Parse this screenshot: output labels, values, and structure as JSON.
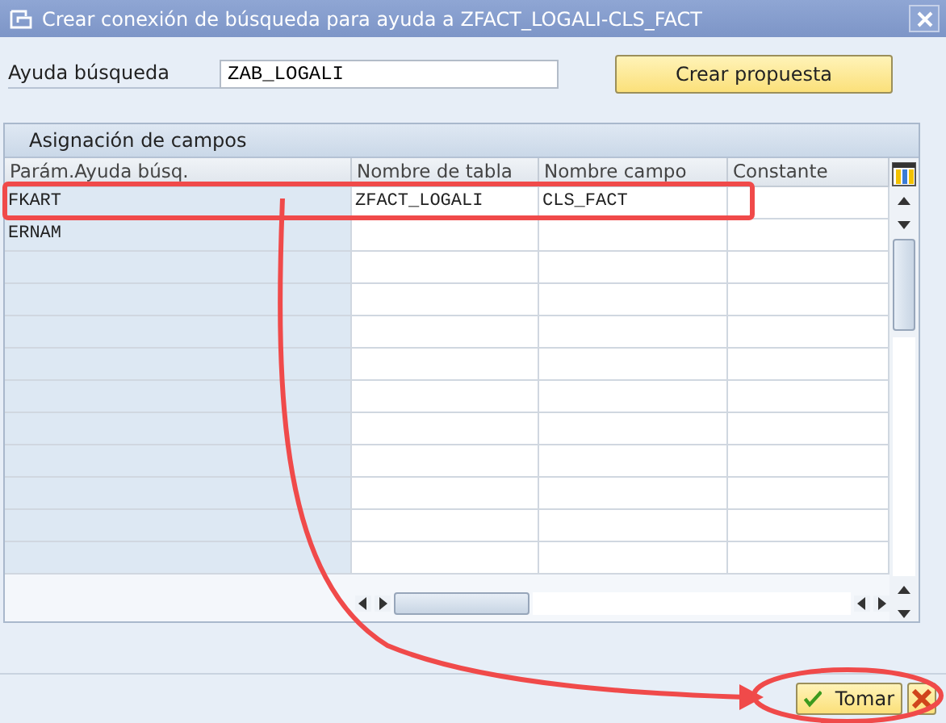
{
  "window": {
    "title": "Crear conexión de búsqueda para ayuda a ZFACT_LOGALI-CLS_FACT"
  },
  "search_help": {
    "label": "Ayuda búsqueda",
    "value": "ZAB_LOGALI"
  },
  "propose_button": "Crear propuesta",
  "table": {
    "title": "Asignación de campos",
    "columns": [
      "Parám.Ayuda búsq.",
      "Nombre de tabla",
      "Nombre campo",
      "Constante"
    ],
    "rows": [
      {
        "cells": [
          "FKART",
          "ZFACT_LOGALI",
          "CLS_FACT",
          ""
        ]
      },
      {
        "cells": [
          "ERNAM",
          "",
          "",
          ""
        ]
      }
    ]
  },
  "buttons": [
    {
      "kind": "ok",
      "label": "Tomar"
    },
    {
      "kind": "cancel"
    }
  ]
}
